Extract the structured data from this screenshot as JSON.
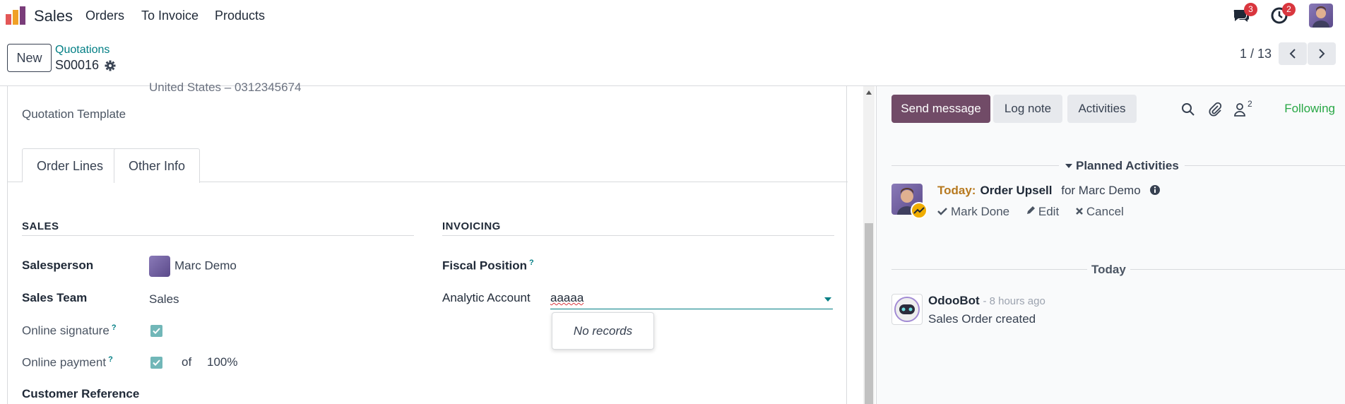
{
  "topnav": {
    "app_name": "Sales",
    "menu": [
      "Orders",
      "To Invoice",
      "Products"
    ],
    "messages_count": "3",
    "activities_count": "2"
  },
  "controlbar": {
    "new_label": "New",
    "breadcrumb_parent": "Quotations",
    "record_name": "S00016",
    "pager": "1 / 13"
  },
  "form": {
    "cut_text": "United States – 0312345674",
    "quotation_template_label": "Quotation Template",
    "tabs": [
      "Order Lines",
      "Other Info"
    ],
    "sales_section": "SALES",
    "invoicing_section": "INVOICING",
    "salesperson_label": "Salesperson",
    "salesperson_value": "Marc Demo",
    "sales_team_label": "Sales Team",
    "sales_team_value": "Sales",
    "online_signature_label": "Online signature",
    "online_payment_label": "Online payment",
    "payment_of": "of",
    "payment_pct": "100%",
    "customer_ref_label": "Customer Reference",
    "fiscal_position_label": "Fiscal Position",
    "analytic_account_label": "Analytic Account",
    "analytic_account_value": "aaaaa",
    "dropdown_empty": "No records",
    "help_mark": "?"
  },
  "chatter": {
    "send_message": "Send message",
    "log_note": "Log note",
    "activities": "Activities",
    "followers_count": "2",
    "following": "Following",
    "planned_activities": "Planned Activities",
    "activity": {
      "when": "Today:",
      "title": "Order Upsell",
      "for": "for Marc Demo",
      "mark_done": "Mark Done",
      "edit": "Edit",
      "cancel": "Cancel"
    },
    "date_separator": "Today",
    "message": {
      "author": "OdooBot",
      "time": "- 8 hours ago",
      "body": "Sales Order created"
    }
  }
}
